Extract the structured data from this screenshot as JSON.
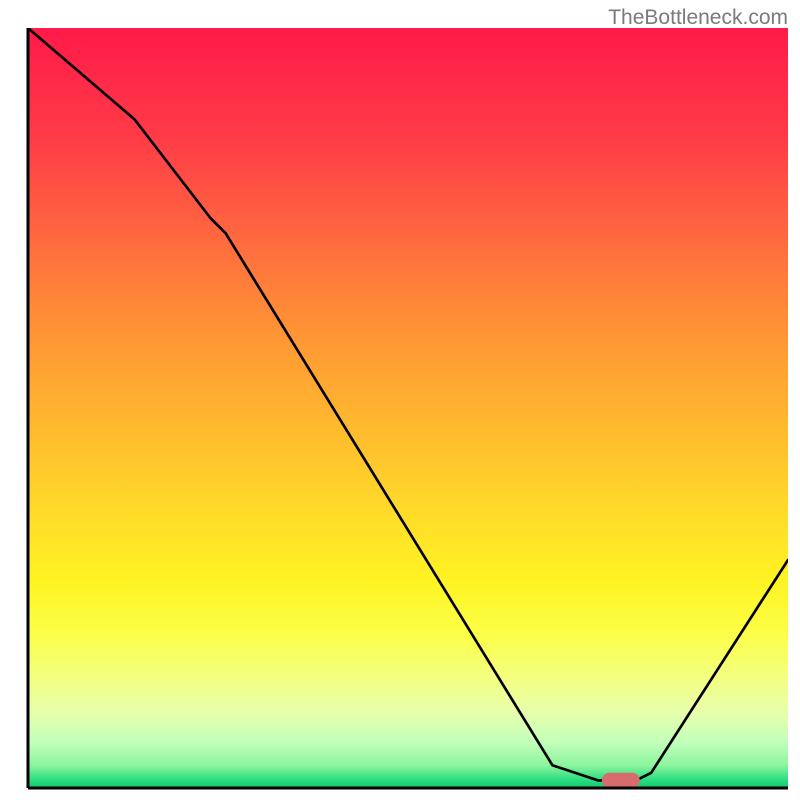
{
  "watermark": "TheBottleneck.com",
  "chart_data": {
    "type": "line",
    "title": "",
    "xlabel": "",
    "ylabel": "",
    "xlim": [
      0,
      100
    ],
    "ylim": [
      0,
      100
    ],
    "series": [
      {
        "name": "bottleneck-curve",
        "x": [
          0,
          14,
          24,
          26,
          69,
          75,
          80,
          82,
          100
        ],
        "y": [
          100,
          88,
          75,
          73,
          3,
          1,
          1,
          2,
          30
        ]
      }
    ],
    "marker": {
      "name": "optimal-indicator",
      "x": 78,
      "y": 1,
      "color": "#d86b6e",
      "width_pct": 5,
      "height_pct": 2
    },
    "gradient_stops": [
      {
        "pct": 0,
        "color": "#ff1a49"
      },
      {
        "pct": 14,
        "color": "#ff3a47"
      },
      {
        "pct": 28,
        "color": "#ff6a3f"
      },
      {
        "pct": 40,
        "color": "#ff9435"
      },
      {
        "pct": 52,
        "color": "#ffb82f"
      },
      {
        "pct": 63,
        "color": "#ffd929"
      },
      {
        "pct": 73,
        "color": "#fff423"
      },
      {
        "pct": 80,
        "color": "#fbff4a"
      },
      {
        "pct": 85,
        "color": "#f4ff7c"
      },
      {
        "pct": 90,
        "color": "#e8ffab"
      },
      {
        "pct": 94,
        "color": "#c2ffbb"
      },
      {
        "pct": 97,
        "color": "#8cf59e"
      },
      {
        "pct": 99,
        "color": "#28db7f"
      },
      {
        "pct": 100,
        "color": "#12c96f"
      }
    ]
  }
}
